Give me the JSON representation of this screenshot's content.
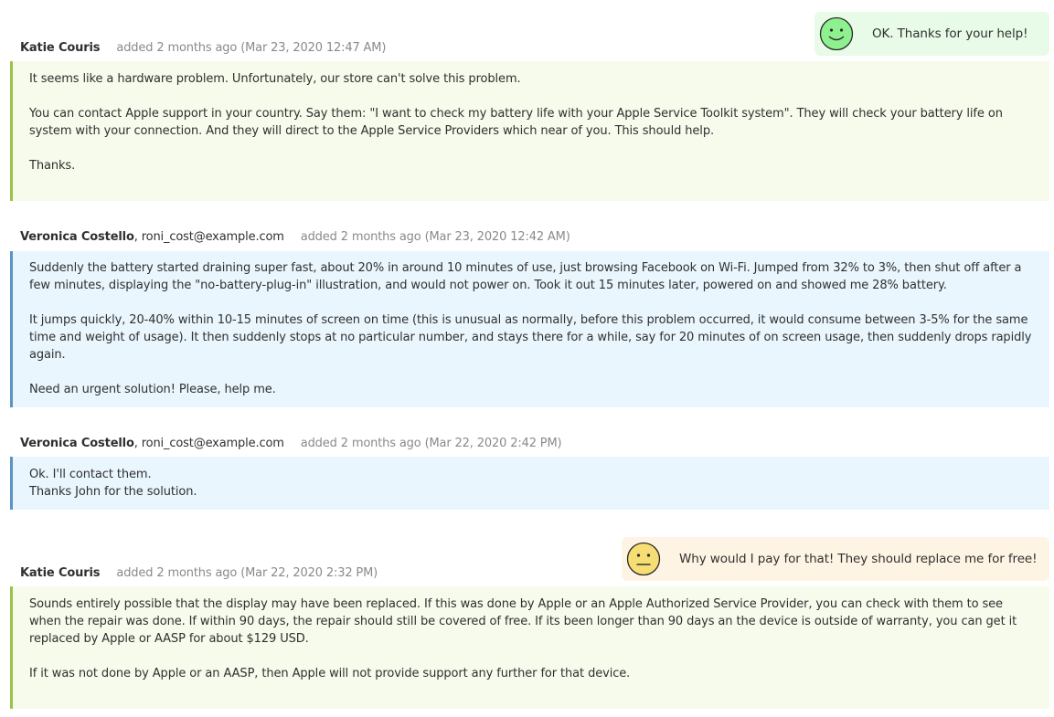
{
  "colors": {
    "admin_bg": "#f6fbec",
    "admin_border": "#9bc24d",
    "customer_bg": "#e9f6fd",
    "customer_border": "#5b94c4",
    "rating_good_bg": "#e8fbe8",
    "rating_neutral_bg": "#fdf4e4"
  },
  "comments": [
    {
      "author": "Katie Couris",
      "added": "added 2 months ago (Mar 23, 2020 12:47 AM)",
      "paragraphs": [
        "It seems like a hardware problem. Unfortunately, our store can't solve this problem.",
        "You can contact Apple support in your country. Say them: \"I want to check my battery life with your Apple Service Toolkit system\". They will check your battery life on system with your connection. And they will direct to the Apple Service Providers which near of you. This should help.",
        "Thanks."
      ],
      "rating": {
        "icon": "happy-face-icon",
        "text": "OK. Thanks for your help!"
      }
    },
    {
      "author": "Veronica Costello",
      "email": ", roni_cost@example.com",
      "added": "added 2 months ago (Mar 23, 2020 12:42 AM)",
      "paragraphs": [
        "Suddenly the battery started draining super fast, about 20% in around 10 minutes of use, just browsing Facebook on Wi-Fi. Jumped from 32% to 3%, then shut off after a few minutes, displaying the \"no-battery-plug-in\" illustration, and would not power on. Took it out 15 minutes later, powered on and showed me 28% battery.",
        "It jumps quickly, 20-40% within 10-15 minutes of screen on time (this is unusual as normally, before this problem occurred, it would consume between 3-5% for the same time and weight of usage). It then suddenly stops at no particular number, and stays there for a while, say for 20 minutes of on screen usage, then suddenly drops rapidly again.",
        "Need an urgent solution! Please, help me."
      ]
    },
    {
      "author": "Veronica Costello",
      "email": ", roni_cost@example.com",
      "added": "added 2 months ago (Mar 22, 2020 2:42 PM)",
      "lines": [
        "Ok. I'll contact them.",
        "Thanks John for the solution."
      ]
    },
    {
      "author": "Katie Couris",
      "added": "added 2 months ago (Mar 22, 2020 2:32 PM)",
      "paragraphs": [
        "Sounds entirely possible that the display may have been replaced.  If this was done by Apple or an Apple Authorized Service Provider, you can check with them to see when the repair was done.  If within 90 days, the repair should still be covered of free.  If its been longer than 90 days an the device is outside of warranty, you can get it replaced by Apple or AASP for about $129 USD.",
        "If it was not done by Apple or an AASP, then Apple will not provide support any further for that device."
      ],
      "rating": {
        "icon": "neutral-face-icon",
        "text": "Why would I pay for that! They should replace me for free!"
      }
    }
  ]
}
